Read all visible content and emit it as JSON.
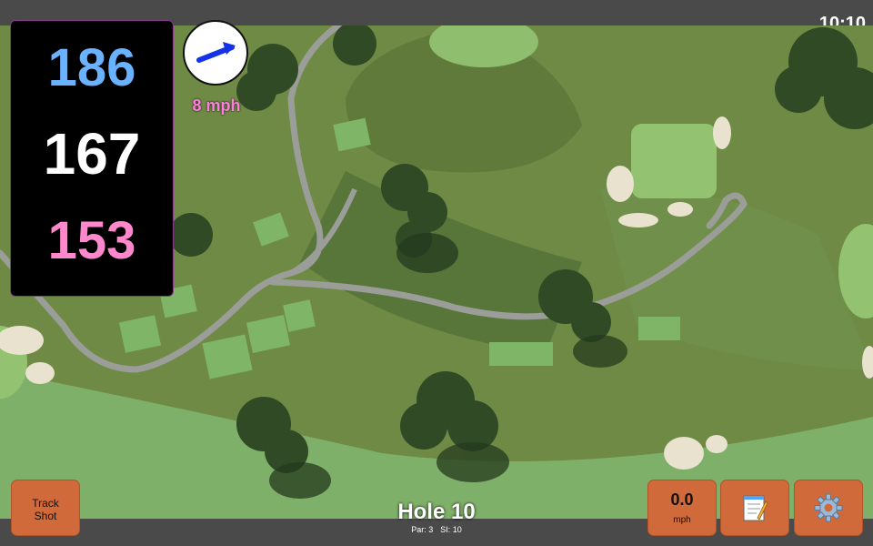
{
  "status": {
    "time": "10:10"
  },
  "yardage": {
    "back": "186",
    "middle": "167",
    "front": "153"
  },
  "wind": {
    "speed_text": "8 mph",
    "direction_icon": "arrow-east"
  },
  "hole": {
    "title": "Hole 10",
    "par": "Par: 3",
    "stroke_index": "SI: 10"
  },
  "buttons": {
    "track_shot": "Track\nShot",
    "speed_value": "0.0",
    "speed_unit": "mph",
    "notes_icon": "notepad-icon",
    "settings_icon": "gear-icon"
  },
  "colors": {
    "back_yardage": "#6ab1ff",
    "middle_yardage": "#ffffff",
    "front_yardage": "#ff88cc",
    "wind_text": "#ff7ee0",
    "button": "#d06a3a"
  }
}
